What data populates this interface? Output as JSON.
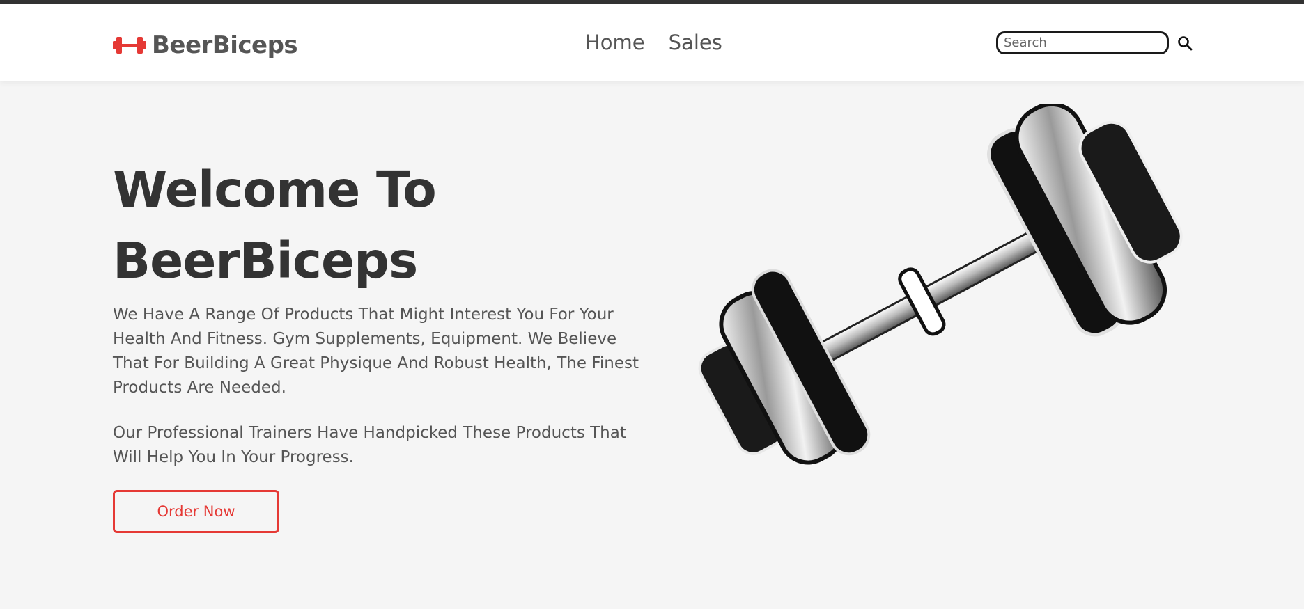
{
  "header": {
    "logo_text": "BeerBiceps",
    "nav": [
      {
        "label": "Home"
      },
      {
        "label": "Sales"
      }
    ],
    "search": {
      "placeholder": "Search",
      "value": ""
    }
  },
  "hero": {
    "title_line1": "Welcome To",
    "title_line2": "BeerBiceps",
    "paragraph1": "We Have A Range Of Products That Might Interest You For Your Health And Fitness. Gym Supplements, Equipment. We Believe That For Building A Great Physique And Robust Health, The Finest Products Are Needed.",
    "paragraph2": "Our Professional Trainers Have Handpicked These Products That Will Help You In Your Progress.",
    "cta_label": "Order Now"
  },
  "colors": {
    "accent": "#e53935",
    "header_bg": "#ffffff",
    "page_bg": "#f5f5f5",
    "top_strip": "#333333",
    "text_dark": "#333333",
    "text_muted": "#555555"
  },
  "icons": {
    "logo": "dumbbell-icon",
    "search": "search-icon",
    "hero_image": "dumbbell-photo"
  }
}
